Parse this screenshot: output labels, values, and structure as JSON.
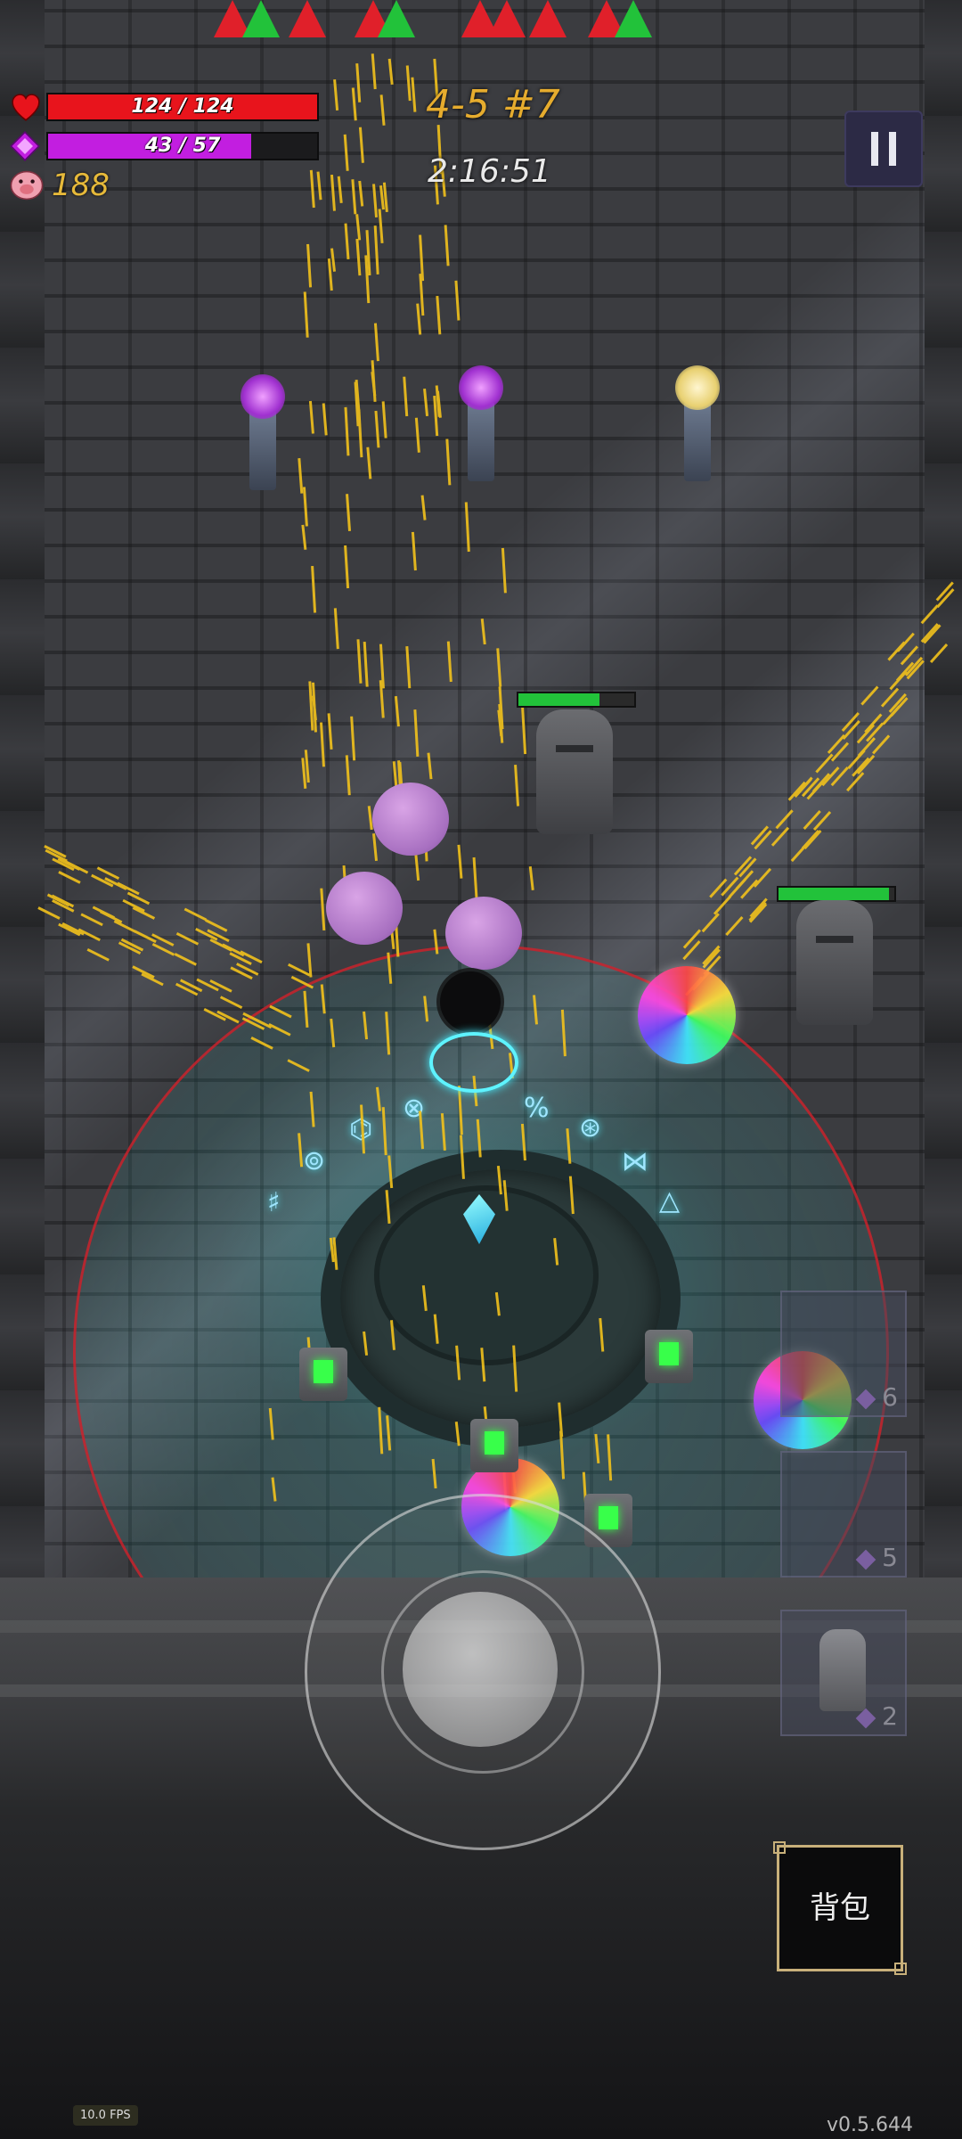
{
  "hud": {
    "hp_text": "124 / 124",
    "hp_current": 124,
    "hp_max": 124,
    "mana_text": "43 / 57",
    "mana_current": 43,
    "mana_max": 57,
    "coins": "188",
    "stage": "4-5 #7",
    "timer": "2:16:51",
    "hp_color": "#e8141c",
    "mana_color": "#c21ee0",
    "stage_color": "#e6ac2e"
  },
  "enemy_markers": [
    {
      "color": "red"
    },
    {
      "color": "green"
    },
    {
      "color": "red"
    },
    {
      "color": "red"
    },
    {
      "color": "green"
    },
    {
      "color": "red"
    },
    {
      "color": "red"
    },
    {
      "color": "red"
    },
    {
      "color": "red"
    },
    {
      "color": "green"
    }
  ],
  "enemies": [
    {
      "name": "statue",
      "hp_fraction": 0.7
    },
    {
      "name": "statue",
      "hp_fraction": 0.95
    }
  ],
  "skill_slots": [
    {
      "icon": "potion-icon",
      "count": "6"
    },
    {
      "icon": "orb-icon",
      "count": "5"
    },
    {
      "icon": "statue-icon",
      "count": "2"
    }
  ],
  "buttons": {
    "bag_label": "背包",
    "pause_icon": "pause-icon"
  },
  "footer": {
    "fps": "10.0 FPS",
    "version": "v0.5.644"
  },
  "runes": [
    "⊚",
    "⌬",
    "⊗",
    "%",
    "⊛",
    "⋈",
    "⧖",
    "♯",
    "◎",
    "△"
  ]
}
